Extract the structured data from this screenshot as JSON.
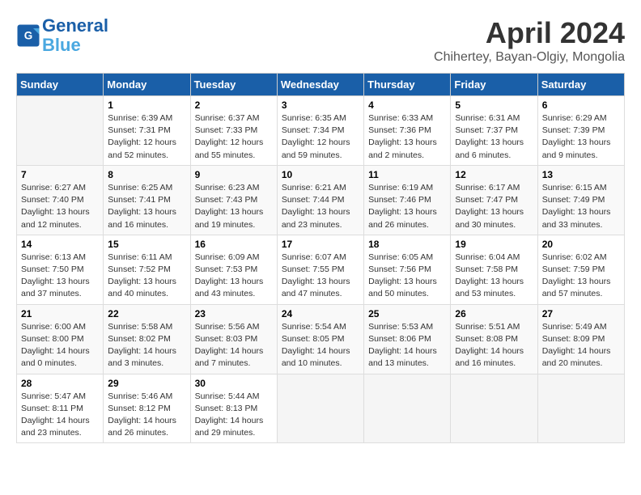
{
  "header": {
    "logo_line1": "General",
    "logo_line2": "Blue",
    "month_title": "April 2024",
    "subtitle": "Chihertey, Bayan-Olgiy, Mongolia"
  },
  "days_of_week": [
    "Sunday",
    "Monday",
    "Tuesday",
    "Wednesday",
    "Thursday",
    "Friday",
    "Saturday"
  ],
  "weeks": [
    [
      {
        "day": "",
        "info": ""
      },
      {
        "day": "1",
        "info": "Sunrise: 6:39 AM\nSunset: 7:31 PM\nDaylight: 12 hours\nand 52 minutes."
      },
      {
        "day": "2",
        "info": "Sunrise: 6:37 AM\nSunset: 7:33 PM\nDaylight: 12 hours\nand 55 minutes."
      },
      {
        "day": "3",
        "info": "Sunrise: 6:35 AM\nSunset: 7:34 PM\nDaylight: 12 hours\nand 59 minutes."
      },
      {
        "day": "4",
        "info": "Sunrise: 6:33 AM\nSunset: 7:36 PM\nDaylight: 13 hours\nand 2 minutes."
      },
      {
        "day": "5",
        "info": "Sunrise: 6:31 AM\nSunset: 7:37 PM\nDaylight: 13 hours\nand 6 minutes."
      },
      {
        "day": "6",
        "info": "Sunrise: 6:29 AM\nSunset: 7:39 PM\nDaylight: 13 hours\nand 9 minutes."
      }
    ],
    [
      {
        "day": "7",
        "info": "Sunrise: 6:27 AM\nSunset: 7:40 PM\nDaylight: 13 hours\nand 12 minutes."
      },
      {
        "day": "8",
        "info": "Sunrise: 6:25 AM\nSunset: 7:41 PM\nDaylight: 13 hours\nand 16 minutes."
      },
      {
        "day": "9",
        "info": "Sunrise: 6:23 AM\nSunset: 7:43 PM\nDaylight: 13 hours\nand 19 minutes."
      },
      {
        "day": "10",
        "info": "Sunrise: 6:21 AM\nSunset: 7:44 PM\nDaylight: 13 hours\nand 23 minutes."
      },
      {
        "day": "11",
        "info": "Sunrise: 6:19 AM\nSunset: 7:46 PM\nDaylight: 13 hours\nand 26 minutes."
      },
      {
        "day": "12",
        "info": "Sunrise: 6:17 AM\nSunset: 7:47 PM\nDaylight: 13 hours\nand 30 minutes."
      },
      {
        "day": "13",
        "info": "Sunrise: 6:15 AM\nSunset: 7:49 PM\nDaylight: 13 hours\nand 33 minutes."
      }
    ],
    [
      {
        "day": "14",
        "info": "Sunrise: 6:13 AM\nSunset: 7:50 PM\nDaylight: 13 hours\nand 37 minutes."
      },
      {
        "day": "15",
        "info": "Sunrise: 6:11 AM\nSunset: 7:52 PM\nDaylight: 13 hours\nand 40 minutes."
      },
      {
        "day": "16",
        "info": "Sunrise: 6:09 AM\nSunset: 7:53 PM\nDaylight: 13 hours\nand 43 minutes."
      },
      {
        "day": "17",
        "info": "Sunrise: 6:07 AM\nSunset: 7:55 PM\nDaylight: 13 hours\nand 47 minutes."
      },
      {
        "day": "18",
        "info": "Sunrise: 6:05 AM\nSunset: 7:56 PM\nDaylight: 13 hours\nand 50 minutes."
      },
      {
        "day": "19",
        "info": "Sunrise: 6:04 AM\nSunset: 7:58 PM\nDaylight: 13 hours\nand 53 minutes."
      },
      {
        "day": "20",
        "info": "Sunrise: 6:02 AM\nSunset: 7:59 PM\nDaylight: 13 hours\nand 57 minutes."
      }
    ],
    [
      {
        "day": "21",
        "info": "Sunrise: 6:00 AM\nSunset: 8:00 PM\nDaylight: 14 hours\nand 0 minutes."
      },
      {
        "day": "22",
        "info": "Sunrise: 5:58 AM\nSunset: 8:02 PM\nDaylight: 14 hours\nand 3 minutes."
      },
      {
        "day": "23",
        "info": "Sunrise: 5:56 AM\nSunset: 8:03 PM\nDaylight: 14 hours\nand 7 minutes."
      },
      {
        "day": "24",
        "info": "Sunrise: 5:54 AM\nSunset: 8:05 PM\nDaylight: 14 hours\nand 10 minutes."
      },
      {
        "day": "25",
        "info": "Sunrise: 5:53 AM\nSunset: 8:06 PM\nDaylight: 14 hours\nand 13 minutes."
      },
      {
        "day": "26",
        "info": "Sunrise: 5:51 AM\nSunset: 8:08 PM\nDaylight: 14 hours\nand 16 minutes."
      },
      {
        "day": "27",
        "info": "Sunrise: 5:49 AM\nSunset: 8:09 PM\nDaylight: 14 hours\nand 20 minutes."
      }
    ],
    [
      {
        "day": "28",
        "info": "Sunrise: 5:47 AM\nSunset: 8:11 PM\nDaylight: 14 hours\nand 23 minutes."
      },
      {
        "day": "29",
        "info": "Sunrise: 5:46 AM\nSunset: 8:12 PM\nDaylight: 14 hours\nand 26 minutes."
      },
      {
        "day": "30",
        "info": "Sunrise: 5:44 AM\nSunset: 8:13 PM\nDaylight: 14 hours\nand 29 minutes."
      },
      {
        "day": "",
        "info": ""
      },
      {
        "day": "",
        "info": ""
      },
      {
        "day": "",
        "info": ""
      },
      {
        "day": "",
        "info": ""
      }
    ]
  ]
}
